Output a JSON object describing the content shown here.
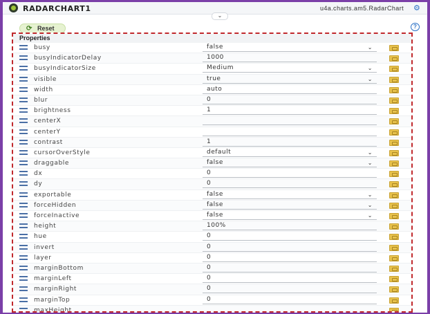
{
  "app": {
    "title": "RADARCHART1",
    "class_name": "u4a.charts.am5.RadarChart"
  },
  "toolbar": {
    "reset_label": "Reset"
  },
  "panel": {
    "title": "Properties"
  },
  "properties": [
    {
      "label": "busy",
      "value": "false",
      "type": "select"
    },
    {
      "label": "busyIndicatorDelay",
      "value": "1000",
      "type": "input"
    },
    {
      "label": "busyIndicatorSize",
      "value": "Medium",
      "type": "select"
    },
    {
      "label": "visible",
      "value": "true",
      "type": "select"
    },
    {
      "label": "width",
      "value": "auto",
      "type": "input"
    },
    {
      "label": "blur",
      "value": "0",
      "type": "input"
    },
    {
      "label": "brightness",
      "value": "1",
      "type": "input"
    },
    {
      "label": "centerX",
      "value": "",
      "type": "input"
    },
    {
      "label": "centerY",
      "value": "",
      "type": "input"
    },
    {
      "label": "contrast",
      "value": "1",
      "type": "input"
    },
    {
      "label": "cursorOverStyle",
      "value": "default",
      "type": "select"
    },
    {
      "label": "draggable",
      "value": "false",
      "type": "select"
    },
    {
      "label": "dx",
      "value": "0",
      "type": "input"
    },
    {
      "label": "dy",
      "value": "0",
      "type": "input"
    },
    {
      "label": "exportable",
      "value": "false",
      "type": "select"
    },
    {
      "label": "forceHidden",
      "value": "false",
      "type": "select"
    },
    {
      "label": "forceInactive",
      "value": "false",
      "type": "select"
    },
    {
      "label": "height",
      "value": "100%",
      "type": "input"
    },
    {
      "label": "hue",
      "value": "0",
      "type": "input"
    },
    {
      "label": "invert",
      "value": "0",
      "type": "input"
    },
    {
      "label": "layer",
      "value": "0",
      "type": "input"
    },
    {
      "label": "marginBottom",
      "value": "0",
      "type": "input"
    },
    {
      "label": "marginLeft",
      "value": "0",
      "type": "input"
    },
    {
      "label": "marginRight",
      "value": "0",
      "type": "input"
    },
    {
      "label": "marginTop",
      "value": "0",
      "type": "input"
    },
    {
      "label": "maxHeight",
      "value": "",
      "type": "input"
    }
  ],
  "colors": {
    "frame": "#7b3fa8",
    "panel_border": "#c0282c",
    "accent": "#2a70c6",
    "reset_bg": "#e6f2d1"
  }
}
